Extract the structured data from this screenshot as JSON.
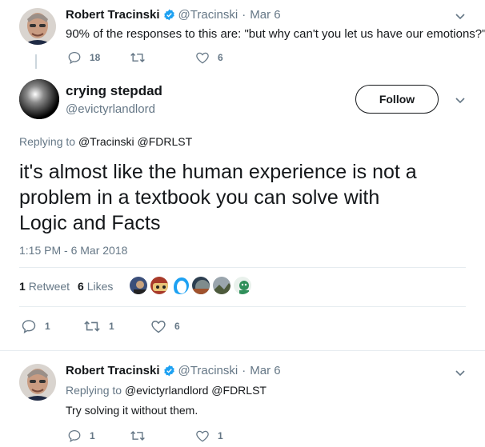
{
  "tweet1": {
    "author_name": "Robert Tracinski",
    "handle": "@Tracinski",
    "sep": "·",
    "date": "Mar 6",
    "text": "90% of the responses to this are: \"but why can't you let us have our emotions?\"",
    "replies": "18",
    "retweets": "",
    "likes": "6"
  },
  "main_tweet": {
    "author_name": "crying stepdad",
    "handle": "@evictyrlandlord",
    "follow_label": "Follow",
    "replying_prefix": "Replying to",
    "reply_to": "@Tracinski @FDRLST",
    "text_line1": "it's almost like the human experience is not a",
    "text_line2": "problem in a textbook you can solve with",
    "text_line3": "Logic and Facts",
    "timestamp": "1:15 PM - 6 Mar 2018",
    "retweet_count": "1",
    "retweet_label": "Retweet",
    "like_count": "6",
    "like_label": "Likes",
    "replies": "1",
    "retweets": "1",
    "likes": "6"
  },
  "tweet3": {
    "author_name": "Robert Tracinski",
    "handle": "@Tracinski",
    "sep": "·",
    "date": "Mar 6",
    "replying_prefix": "Replying to",
    "reply_to": "@evictyrlandlord @FDRLST",
    "text": "Try solving it without them.",
    "replies": "1",
    "retweets": "",
    "likes": "1"
  },
  "colors": {
    "verified": "#1da1f2",
    "muted": "#657786",
    "text": "#14171a"
  },
  "icons": [
    "verified-badge-icon",
    "reply-icon",
    "retweet-icon",
    "like-icon",
    "chevron-down-icon"
  ]
}
